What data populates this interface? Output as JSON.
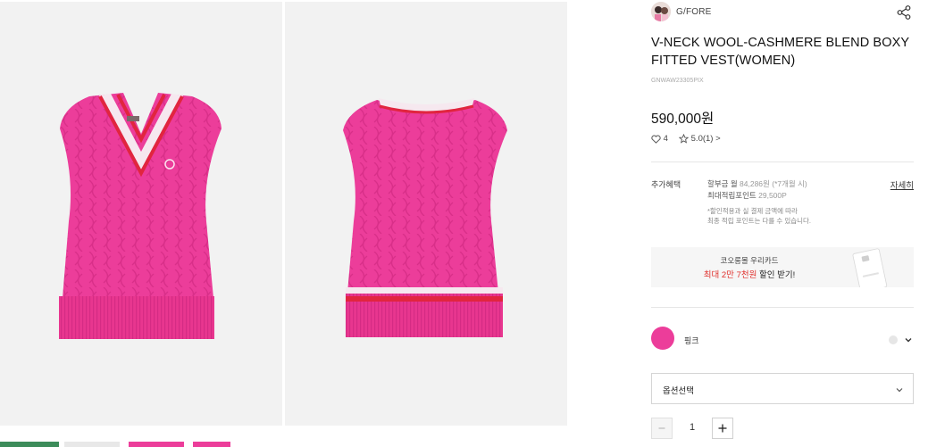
{
  "brand": {
    "name": "G/FORE"
  },
  "product": {
    "title": "V-NECK WOOL-CASHMERE BLEND BOXY FITTED VEST(WOMEN)",
    "code": "GNWAW23305PIX",
    "price": "590,000원",
    "likes": "4",
    "rating": "5.0",
    "review_count": "(1)",
    "review_arrow": ">",
    "color_hex": "#ec3d9a"
  },
  "benefits": {
    "label": "추가혜택",
    "installment_label": "할부금 월",
    "installment_value": "84,286원",
    "installment_months": "(*7개월 시)",
    "points_label": "최대적립포인트",
    "points_value": "29,500P",
    "note_line1": "*할인적용과 실 결제 금액에 따라",
    "note_line2": "최종 적립 포인트는 다를 수 있습니다.",
    "detail_link": "자세히"
  },
  "card_banner": {
    "line1": "코오롱몰 우리카드",
    "line2_prefix": "최대 ",
    "line2_highlight1": "2만",
    "line2_mid": " ",
    "line2_highlight2": "7천원",
    "line2_suffix": " 할인 받기!"
  },
  "color_option": {
    "name": "핑크"
  },
  "option_select": {
    "label": "옵션선택"
  },
  "quantity": {
    "value": "1",
    "minus": "−",
    "plus": "+"
  },
  "colors": {
    "accent_red": "#e0302c",
    "vest_pink": "#ec3d9a",
    "trim_red": "#e1253f",
    "gallery_bg": "#f2f2f2"
  },
  "icons": [
    "share-icon",
    "heart-icon",
    "star-icon",
    "chevron-down-icon",
    "minus-icon",
    "plus-icon"
  ]
}
